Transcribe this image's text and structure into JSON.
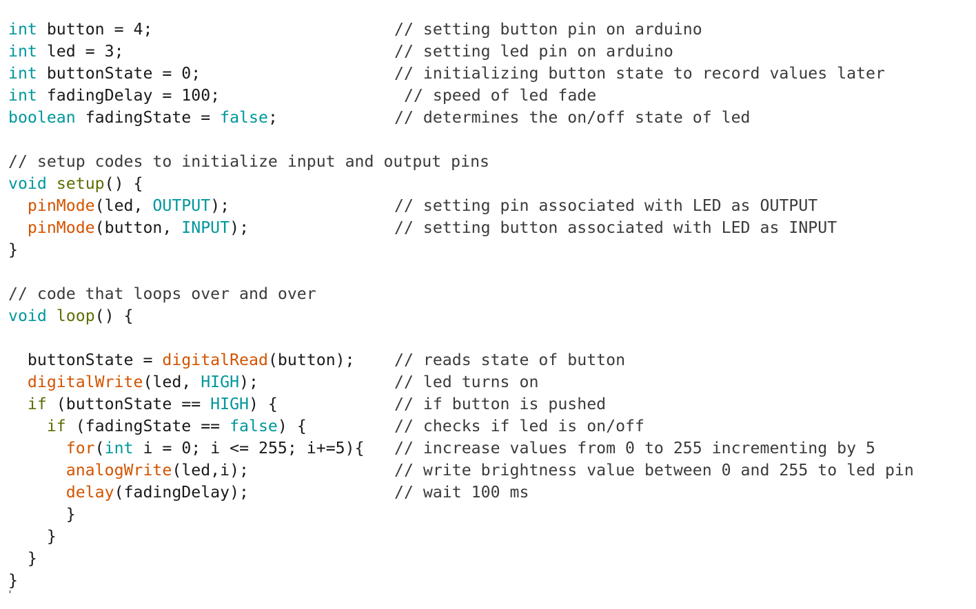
{
  "editor": {
    "lines": [
      {
        "code": [
          {
            "t": "int",
            "c": "kw"
          },
          {
            "t": " button = 4;"
          }
        ],
        "comment": "// setting button pin on arduino"
      },
      {
        "code": [
          {
            "t": "int",
            "c": "kw"
          },
          {
            "t": " led = 3;"
          }
        ],
        "comment": "// setting led pin on arduino"
      },
      {
        "code": [
          {
            "t": "int",
            "c": "kw"
          },
          {
            "t": " buttonState = 0;"
          }
        ],
        "comment": "// initializing button state to record values later"
      },
      {
        "code": [
          {
            "t": "int",
            "c": "kw"
          },
          {
            "t": " fadingDelay = 100;"
          }
        ],
        "comment": "// speed of led fade",
        "shift": true
      },
      {
        "code": [
          {
            "t": "boolean",
            "c": "kw"
          },
          {
            "t": " fadingState = "
          },
          {
            "t": "false",
            "c": "kw"
          },
          {
            "t": ";"
          }
        ],
        "comment": "// determines the on/off state of led"
      },
      {
        "code": []
      },
      {
        "code": [
          {
            "t": "// setup codes to initialize input and output pins",
            "c": "cm"
          }
        ]
      },
      {
        "code": [
          {
            "t": "void",
            "c": "kw"
          },
          {
            "t": " "
          },
          {
            "t": "setup",
            "c": "ctl"
          },
          {
            "t": "() {"
          }
        ]
      },
      {
        "code": [
          {
            "t": "  "
          },
          {
            "t": "pinMode",
            "c": "fn"
          },
          {
            "t": "(led, "
          },
          {
            "t": "OUTPUT",
            "c": "kw"
          },
          {
            "t": ");"
          }
        ],
        "comment": "// setting pin associated with LED as OUTPUT"
      },
      {
        "code": [
          {
            "t": "  "
          },
          {
            "t": "pinMode",
            "c": "fn"
          },
          {
            "t": "(button, "
          },
          {
            "t": "INPUT",
            "c": "kw"
          },
          {
            "t": ");"
          }
        ],
        "comment": "// setting button associated with LED as INPUT"
      },
      {
        "code": [
          {
            "t": "}"
          }
        ]
      },
      {
        "code": []
      },
      {
        "code": [
          {
            "t": "// code that loops over and over",
            "c": "cm"
          }
        ]
      },
      {
        "code": [
          {
            "t": "void",
            "c": "kw"
          },
          {
            "t": " "
          },
          {
            "t": "loop",
            "c": "ctl"
          },
          {
            "t": "() {"
          }
        ]
      },
      {
        "code": []
      },
      {
        "code": [
          {
            "t": "  buttonState = "
          },
          {
            "t": "digitalRead",
            "c": "fn"
          },
          {
            "t": "(button);"
          }
        ],
        "comment": "// reads state of button"
      },
      {
        "code": [
          {
            "t": "  "
          },
          {
            "t": "digitalWrite",
            "c": "fn"
          },
          {
            "t": "(led, "
          },
          {
            "t": "HIGH",
            "c": "kw"
          },
          {
            "t": ");"
          }
        ],
        "comment": "// led turns on"
      },
      {
        "code": [
          {
            "t": "  "
          },
          {
            "t": "if",
            "c": "ctl"
          },
          {
            "t": " (buttonState == "
          },
          {
            "t": "HIGH",
            "c": "kw"
          },
          {
            "t": ") {"
          }
        ],
        "comment": "// if button is pushed"
      },
      {
        "code": [
          {
            "t": "    "
          },
          {
            "t": "if",
            "c": "ctl"
          },
          {
            "t": " (fadingState == "
          },
          {
            "t": "false",
            "c": "kw"
          },
          {
            "t": ") {"
          }
        ],
        "comment": "// checks if led is on/off"
      },
      {
        "code": [
          {
            "t": "      "
          },
          {
            "t": "for",
            "c": "fn"
          },
          {
            "t": "("
          },
          {
            "t": "int",
            "c": "kw"
          },
          {
            "t": " i = 0; i <= 255; i+=5){"
          }
        ],
        "comment": "// increase values from 0 to 255 incrementing by 5"
      },
      {
        "code": [
          {
            "t": "      "
          },
          {
            "t": "analogWrite",
            "c": "fn"
          },
          {
            "t": "(led,i);"
          }
        ],
        "comment": "// write brightness value between 0 and 255 to led pin"
      },
      {
        "code": [
          {
            "t": "      "
          },
          {
            "t": "delay",
            "c": "fn"
          },
          {
            "t": "(fadingDelay);"
          }
        ],
        "comment": "// wait 100 ms"
      },
      {
        "code": [
          {
            "t": "      }"
          }
        ]
      },
      {
        "code": [
          {
            "t": "    }"
          }
        ]
      },
      {
        "code": [
          {
            "t": "  }"
          }
        ]
      },
      {
        "code": [
          {
            "t": "}"
          }
        ],
        "cursor": true
      }
    ]
  }
}
